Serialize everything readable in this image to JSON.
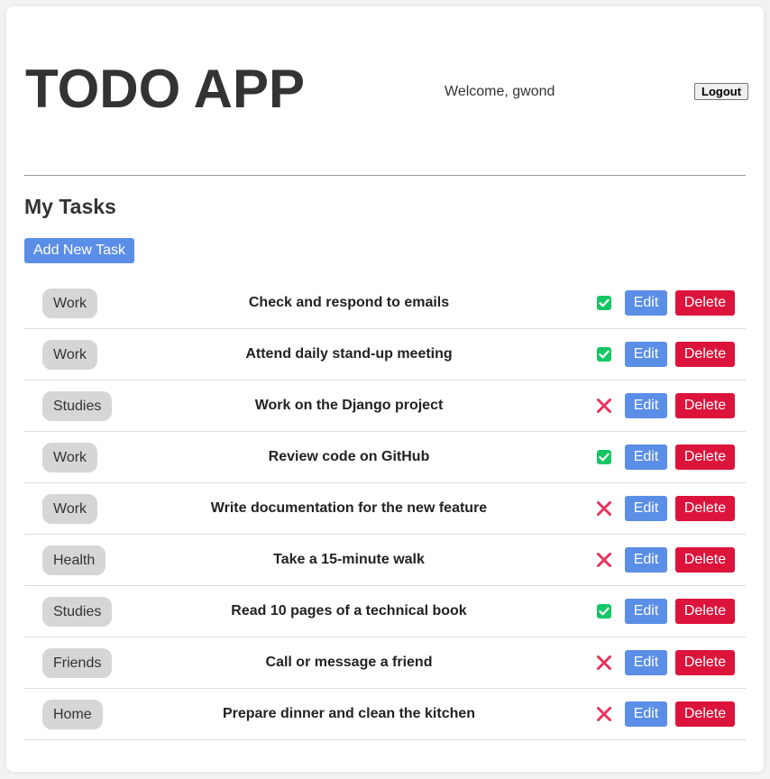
{
  "header": {
    "app_title": "TODO APP",
    "welcome_text": "Welcome, gwond",
    "logout_label": "Logout"
  },
  "main": {
    "section_title": "My Tasks",
    "add_task_label": "Add New Task",
    "edit_label": "Edit",
    "delete_label": "Delete"
  },
  "tasks": [
    {
      "category": "Work",
      "title": "Check and respond to emails",
      "completed": true
    },
    {
      "category": "Work",
      "title": "Attend daily stand-up meeting",
      "completed": true
    },
    {
      "category": "Studies",
      "title": "Work on the Django project",
      "completed": false
    },
    {
      "category": "Work",
      "title": "Review code on GitHub",
      "completed": true
    },
    {
      "category": "Work",
      "title": "Write documentation for the new feature",
      "completed": false
    },
    {
      "category": "Health",
      "title": "Take a 15-minute walk",
      "completed": false
    },
    {
      "category": "Studies",
      "title": "Read 10 pages of a technical book",
      "completed": true
    },
    {
      "category": "Friends",
      "title": "Call or message a friend",
      "completed": false
    },
    {
      "category": "Home",
      "title": "Prepare dinner and clean the kitchen",
      "completed": false
    }
  ],
  "icons": {
    "completed": "check-box-icon",
    "not_completed": "cross-icon"
  },
  "colors": {
    "primary": "#5b8ee6",
    "danger": "#dc143c",
    "completed": "#14c664",
    "not_completed": "#e8335a",
    "badge_bg": "#d6d6d6"
  }
}
